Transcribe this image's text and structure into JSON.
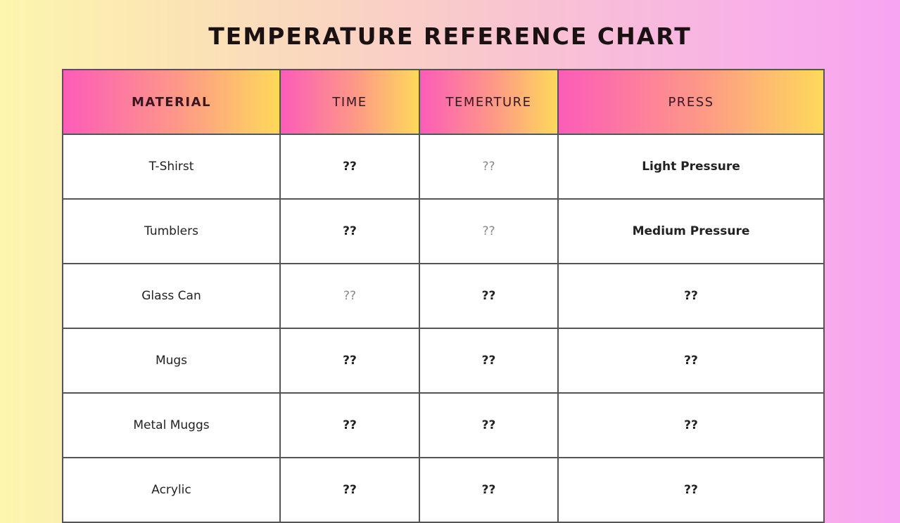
{
  "title": "TEMPERATURE REFERENCE CHART",
  "table": {
    "headers": [
      "MATERIAL",
      "TIME",
      "TEMERTURE",
      "PRESS"
    ],
    "rows": [
      [
        {
          "text": "T-Shirst",
          "bold": false
        },
        {
          "text": "??",
          "bold": true
        },
        {
          "text": "??",
          "bold": false
        },
        {
          "text": "Light Pressure",
          "bold": true
        }
      ],
      [
        {
          "text": "Tumblers",
          "bold": false
        },
        {
          "text": "??",
          "bold": true
        },
        {
          "text": "??",
          "bold": false
        },
        {
          "text": "Medium Pressure",
          "bold": true
        }
      ],
      [
        {
          "text": "Glass Can",
          "bold": false
        },
        {
          "text": "??",
          "bold": false
        },
        {
          "text": "??",
          "bold": true
        },
        {
          "text": "??",
          "bold": true
        }
      ],
      [
        {
          "text": "Mugs",
          "bold": false
        },
        {
          "text": "??",
          "bold": true
        },
        {
          "text": "??",
          "bold": true
        },
        {
          "text": "??",
          "bold": true
        }
      ],
      [
        {
          "text": "Metal Muggs",
          "bold": false
        },
        {
          "text": "??",
          "bold": true
        },
        {
          "text": "??",
          "bold": true
        },
        {
          "text": "??",
          "bold": true
        }
      ],
      [
        {
          "text": "Acrylic",
          "bold": false
        },
        {
          "text": "??",
          "bold": true
        },
        {
          "text": "??",
          "bold": true
        },
        {
          "text": "??",
          "bold": true
        }
      ]
    ]
  },
  "colors": {
    "header_start": "#fc5cb8",
    "header_end": "#fdd95a",
    "background_left": "#fcf6ae",
    "background_right": "#f7a4f2"
  }
}
